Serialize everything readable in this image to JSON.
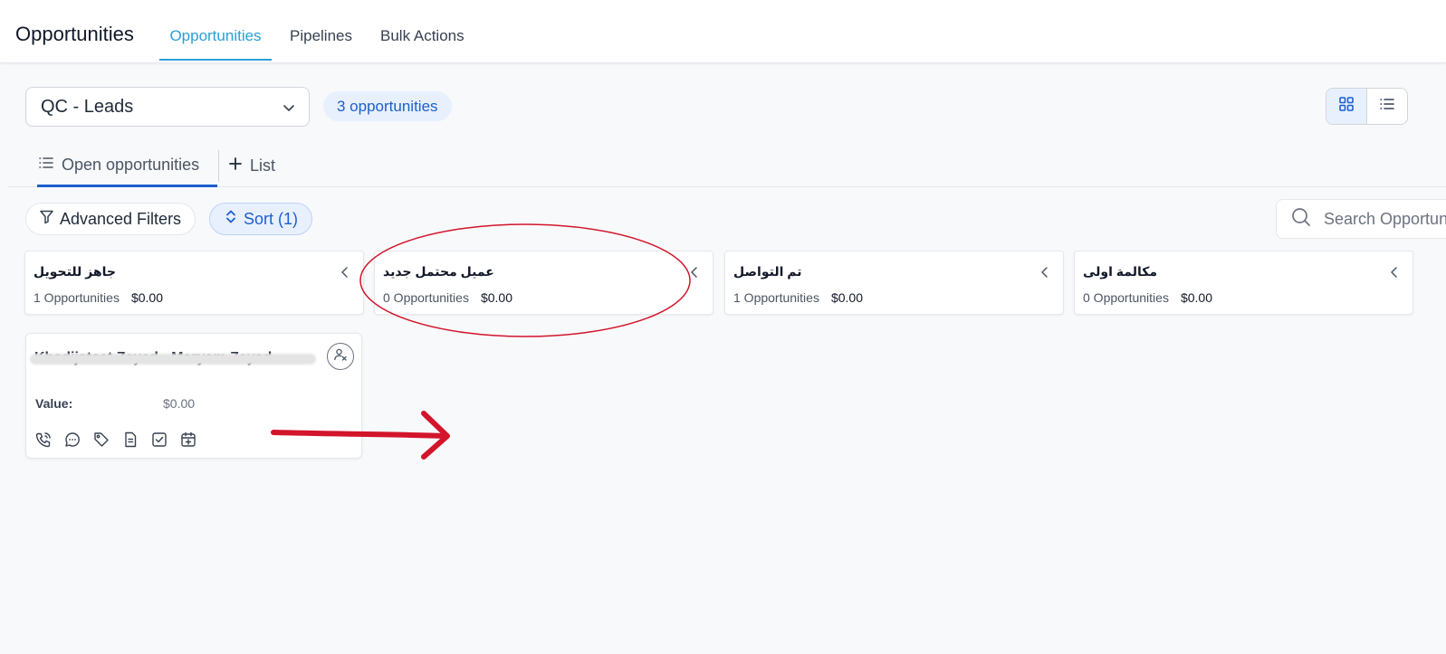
{
  "header": {
    "app_title": "Opportunities",
    "tabs": [
      {
        "label": "Opportunities",
        "active": true
      },
      {
        "label": "Pipelines",
        "active": false
      },
      {
        "label": "Bulk Actions",
        "active": false
      }
    ],
    "accent_color": "#2b9fd8"
  },
  "toolbar": {
    "pipeline_select": {
      "value": "QC - Leads",
      "icon": "chevron-down-icon"
    },
    "count_pill": "3 opportunities",
    "view_toggle": [
      {
        "icon": "grid-icon",
        "active": true
      },
      {
        "icon": "list-icon",
        "active": false
      }
    ]
  },
  "subtabs": [
    {
      "label": "Open opportunities",
      "icon": "list-icon",
      "active": true
    },
    {
      "label": "List",
      "icon": "plus-icon",
      "active": false
    }
  ],
  "filters": {
    "advanced_label": "Advanced Filters",
    "sort_label": "Sort (1)",
    "search_placeholder": "Search Opportunities"
  },
  "stages": [
    {
      "name": "جاهز للتحويل",
      "count": "1 Opportunities",
      "amount": "$0.00"
    },
    {
      "name": "عميل محتمل جديد",
      "count": "0 Opportunities",
      "amount": "$0.00"
    },
    {
      "name": "تم التواصل",
      "count": "1 Opportunities",
      "amount": "$0.00"
    },
    {
      "name": "مكالمة اولى",
      "count": "0 Opportunities",
      "amount": "$0.00"
    }
  ],
  "card": {
    "title": "Khadijateet Zayed - Maryam Zayed",
    "value_label": "Value:",
    "value_amount": "$0.00",
    "actions": [
      "phone-icon",
      "message-icon",
      "tag-icon",
      "document-icon",
      "task-check-icon",
      "calendar-add-icon"
    ]
  },
  "annotation_color": "#d2152b",
  "brand_blue": "#1d5fcf"
}
